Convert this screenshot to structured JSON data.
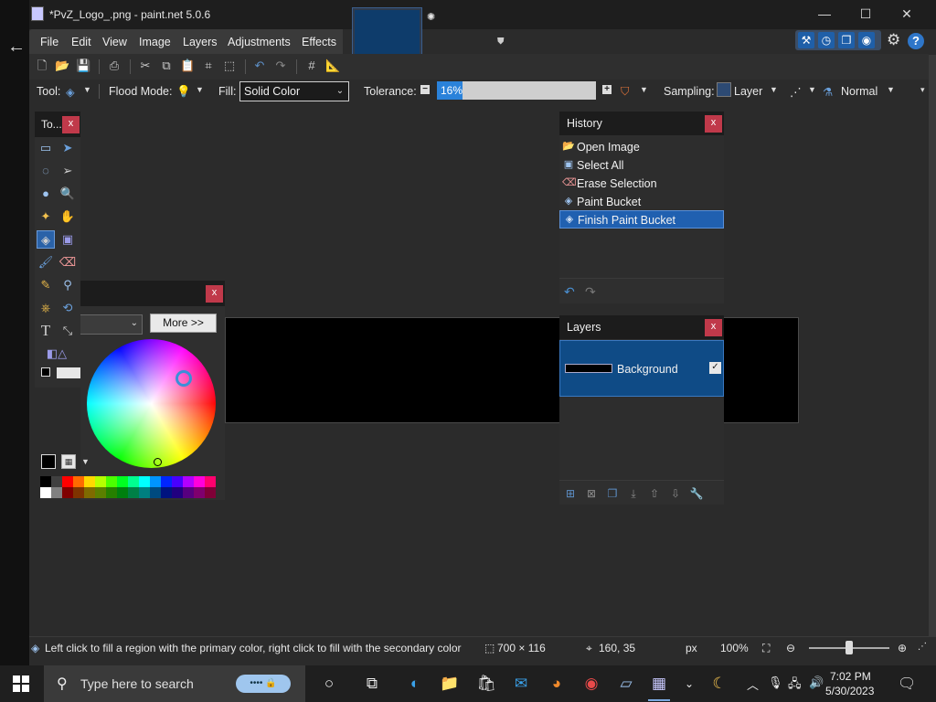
{
  "window": {
    "title": "*PvZ_Logo_.png - paint.net 5.0.6",
    "minimize": "—",
    "maximize": "☐",
    "close": "✕"
  },
  "menu": [
    "File",
    "Edit",
    "View",
    "Image",
    "Layers",
    "Adjustments",
    "Effects"
  ],
  "toolbar2": {
    "tool_label": "Tool:",
    "flood_mode_label": "Flood Mode:",
    "fill_label": "Fill:",
    "fill_value": "Solid Color",
    "tolerance_label": "Tolerance:",
    "tolerance_value": "16%",
    "tolerance_fraction": 0.16,
    "sampling_label": "Sampling:",
    "sampling_value": "Layer",
    "blend_value": "Normal"
  },
  "tools_panel": {
    "title": "To...",
    "close": "x"
  },
  "colors_panel": {
    "close": "x",
    "more_label": "More >>"
  },
  "palette_colors": [
    "#000000",
    "#404040",
    "#ff0000",
    "#ff6a00",
    "#ffd800",
    "#b6ff00",
    "#4cff00",
    "#00ff21",
    "#00ff90",
    "#00ffff",
    "#0094ff",
    "#0026ff",
    "#4800ff",
    "#b200ff",
    "#ff00dc",
    "#ff006e"
  ],
  "palette_colors_dark": [
    "#ffffff",
    "#808080",
    "#7f0000",
    "#7f3300",
    "#7f6a00",
    "#5b7f00",
    "#267f00",
    "#007f0e",
    "#007f46",
    "#007f7f",
    "#004a7f",
    "#00137f",
    "#21007f",
    "#57007f",
    "#7f006e",
    "#7f0037"
  ],
  "history": {
    "title": "History",
    "close": "x",
    "items": [
      {
        "label": "Open Image",
        "icon": "folder-icon"
      },
      {
        "label": "Select All",
        "icon": "select-all-icon"
      },
      {
        "label": "Erase Selection",
        "icon": "erase-selection-icon"
      },
      {
        "label": "Paint Bucket",
        "icon": "paint-bucket-icon"
      },
      {
        "label": "Finish Paint Bucket",
        "icon": "paint-bucket-icon"
      }
    ]
  },
  "layers": {
    "title": "Layers",
    "close": "x",
    "layer_name": "Background",
    "visible_check": "✓"
  },
  "status": {
    "hint": "Left click to fill a region with the primary color, right click to fill with the secondary color",
    "image_size": "700 × 116",
    "cursor_pos": "160, 35",
    "unit": "px",
    "zoom": "100%"
  },
  "taskbar": {
    "search_placeholder": "Type here to search",
    "time": "7:02 PM",
    "date": "5/30/2023"
  }
}
